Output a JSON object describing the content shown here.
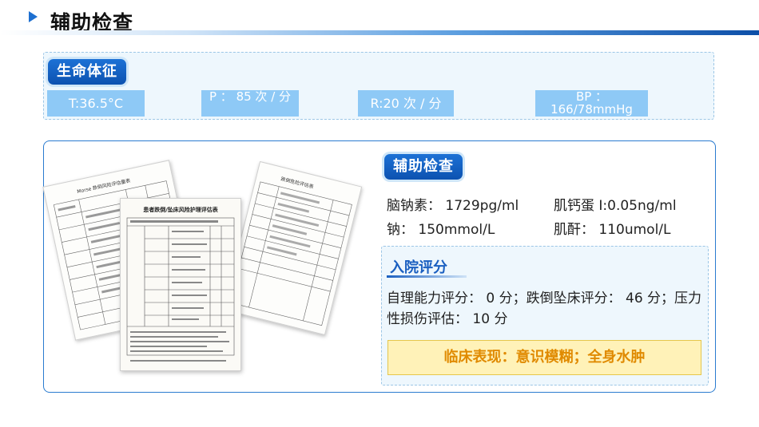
{
  "header": {
    "title": "辅助检查"
  },
  "vitals": {
    "label": "生命体征",
    "temperature": "T:36.5°C",
    "pulse": "P ： 85 次 / 分",
    "respiration": "R:20 次 / 分",
    "blood_pressure": "BP ： 166/78mmHg"
  },
  "aux_exam": {
    "label": "辅助检查",
    "serum_sodium_1": "脑钠素： 1729pg/ml",
    "troponin": "肌钙蛋 I:0.05ng/ml",
    "serum_sodium_2": "钠： 150mmol/L",
    "creatinine": "肌酐： 110umol/L"
  },
  "admission": {
    "title": "入院评分",
    "text": "自理能力评分： 0 分；跌倒坠床评分： 46 分；压力性损伤评估： 10 分",
    "clinical": "临床表现：意识模糊；全身水肿"
  },
  "forms": {
    "front_title": "患者跌倒/坠床风险护理评估表",
    "left_title": "Morse 跌倒风险评估量表",
    "right_title": "跌倒危险评估表"
  },
  "colors": {
    "accent": "#1d6fd0",
    "vital_bg": "#8ec9f6",
    "clinical_text": "#e08a00"
  }
}
